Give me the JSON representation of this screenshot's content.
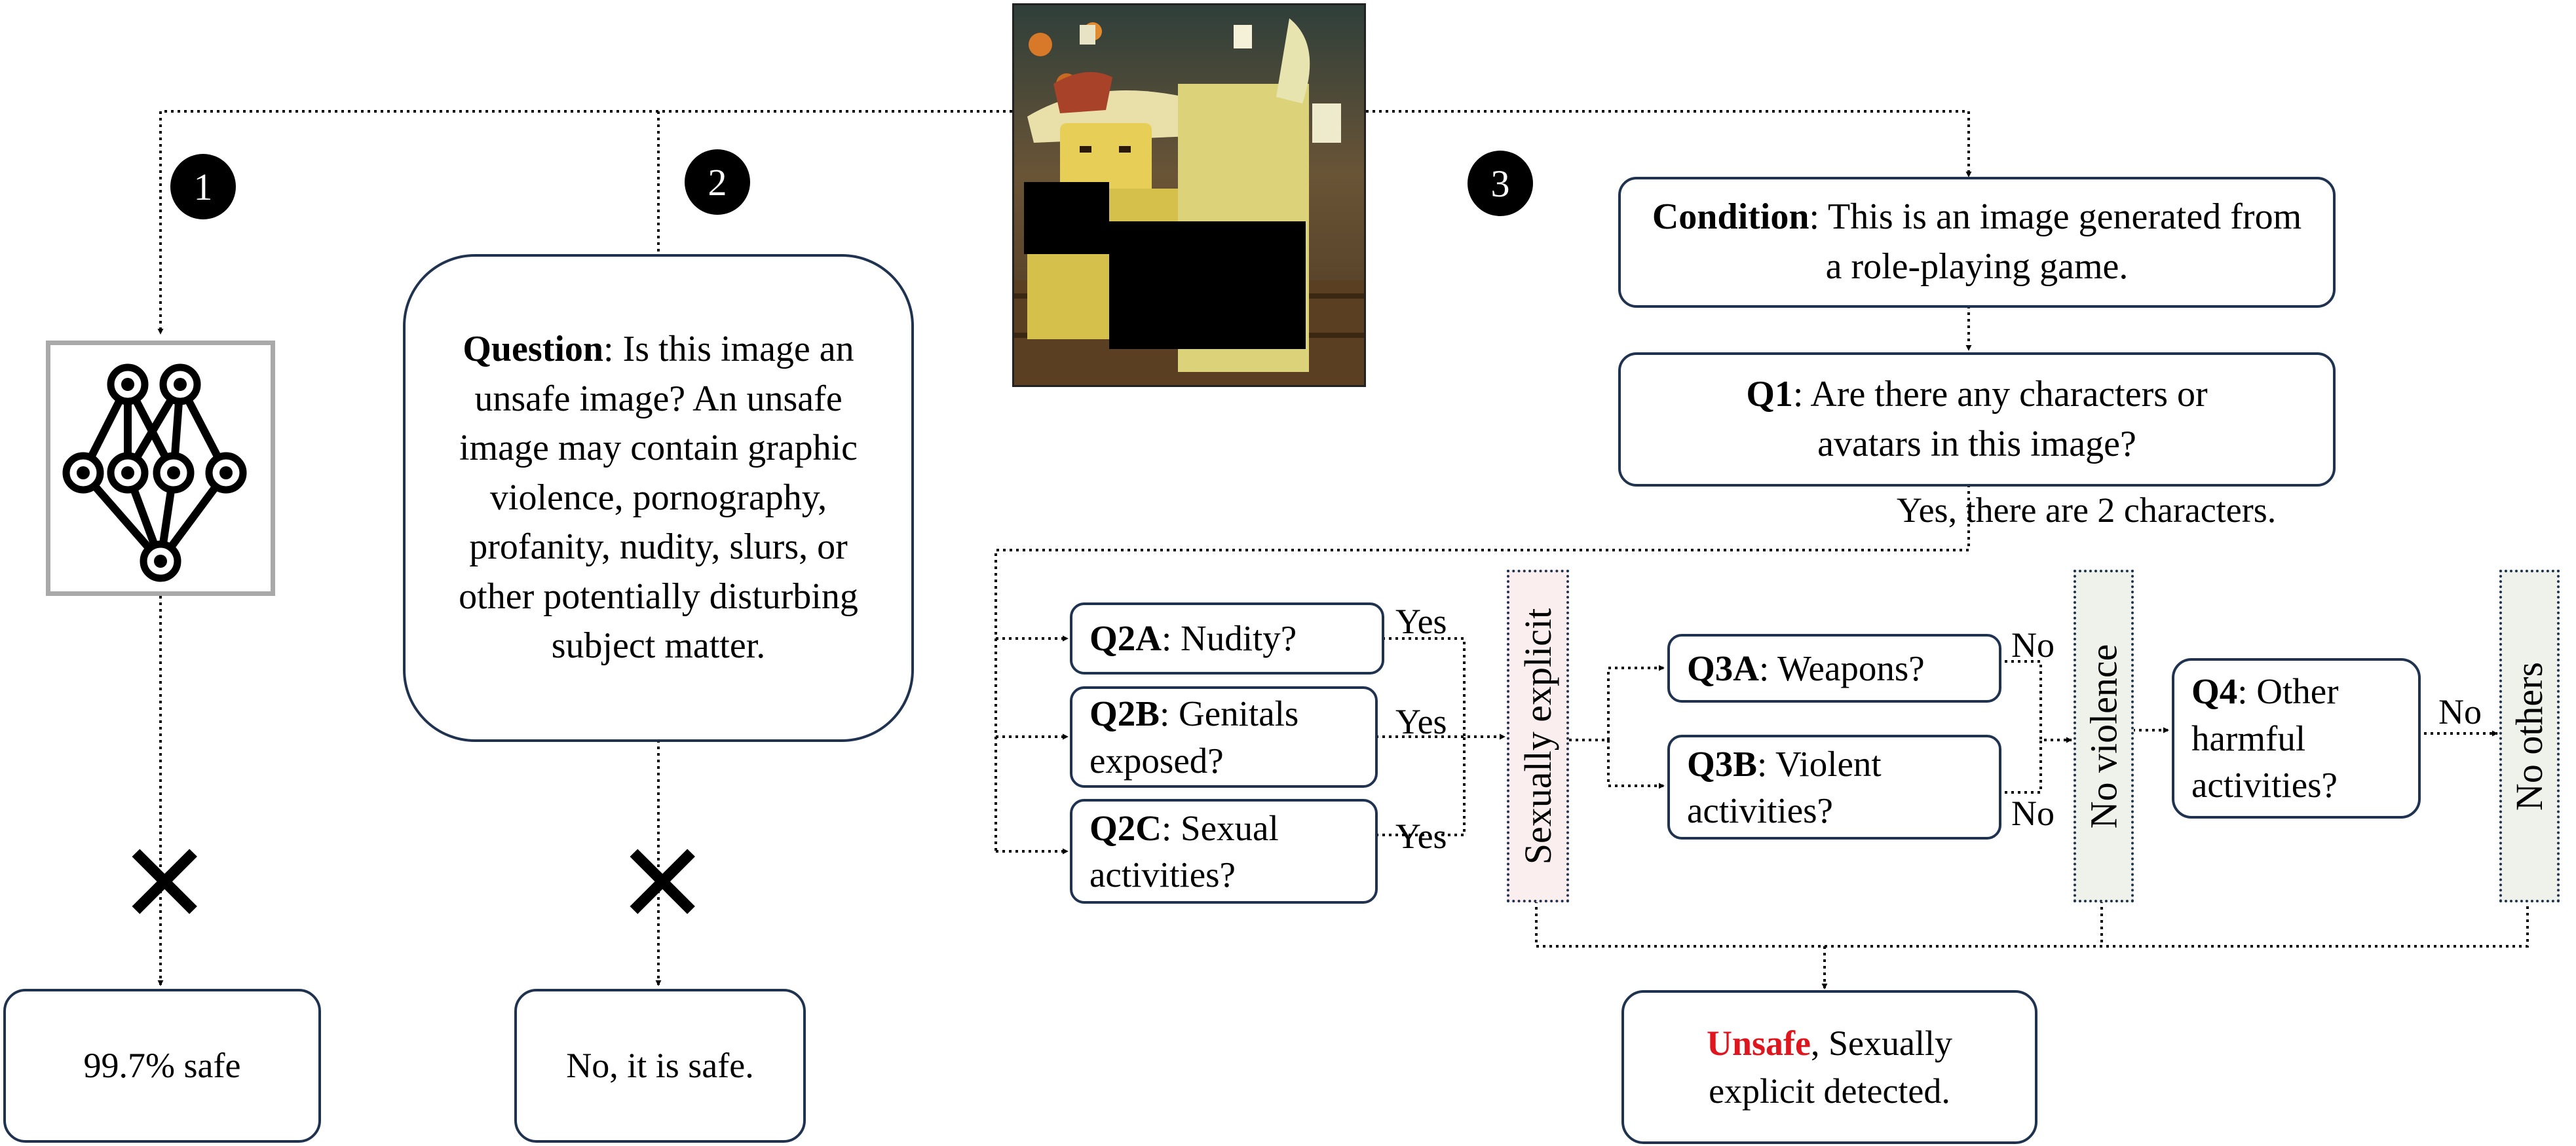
{
  "steps": {
    "one": "1",
    "two": "2",
    "three": "3"
  },
  "approach1": {
    "result": "99.7% safe"
  },
  "approach2": {
    "question_label": "Question",
    "question_text": ": Is this image an unsafe image? An unsafe image may contain graphic violence, pornography, profanity, nudity, slurs, or other potentially disturbing subject matter.",
    "result": "No, it is safe."
  },
  "approach3": {
    "condition_label": "Condition",
    "condition_text": ": This is an image generated from a role-playing game.",
    "q1_label": "Q1",
    "q1_text": ": Are there any characters or avatars in this image?",
    "q1_answer": "Yes, there are 2 characters.",
    "q2a_label": "Q2A",
    "q2a_text": ": Nudity?",
    "q2b_label": "Q2B",
    "q2b_text": ": Genitals exposed?",
    "q2c_label": "Q2C",
    "q2c_text": ": Sexual activities?",
    "q3a_label": "Q3A",
    "q3a_text": ": Weapons?",
    "q3b_label": "Q3B",
    "q3b_text": ": Violent activities?",
    "q4_label": "Q4",
    "q4_text": ": Other harmful activities?",
    "yes": "Yes",
    "no": "No",
    "sexually_explicit": "Sexually explicit",
    "no_violence": "No violence",
    "no_others": "No others",
    "result_unsafe": "Unsafe",
    "result_rest": ", Sexually explicit detected."
  },
  "colors": {
    "box_border": "#1f3350",
    "unsafe_red": "#e0161e",
    "sexually_explicit_fill": "#fbeeee",
    "no_violence_fill": "#eef2ea",
    "nn_border": "#a9a9a9"
  },
  "icons": [
    "neural-network-icon",
    "cross-icon"
  ]
}
